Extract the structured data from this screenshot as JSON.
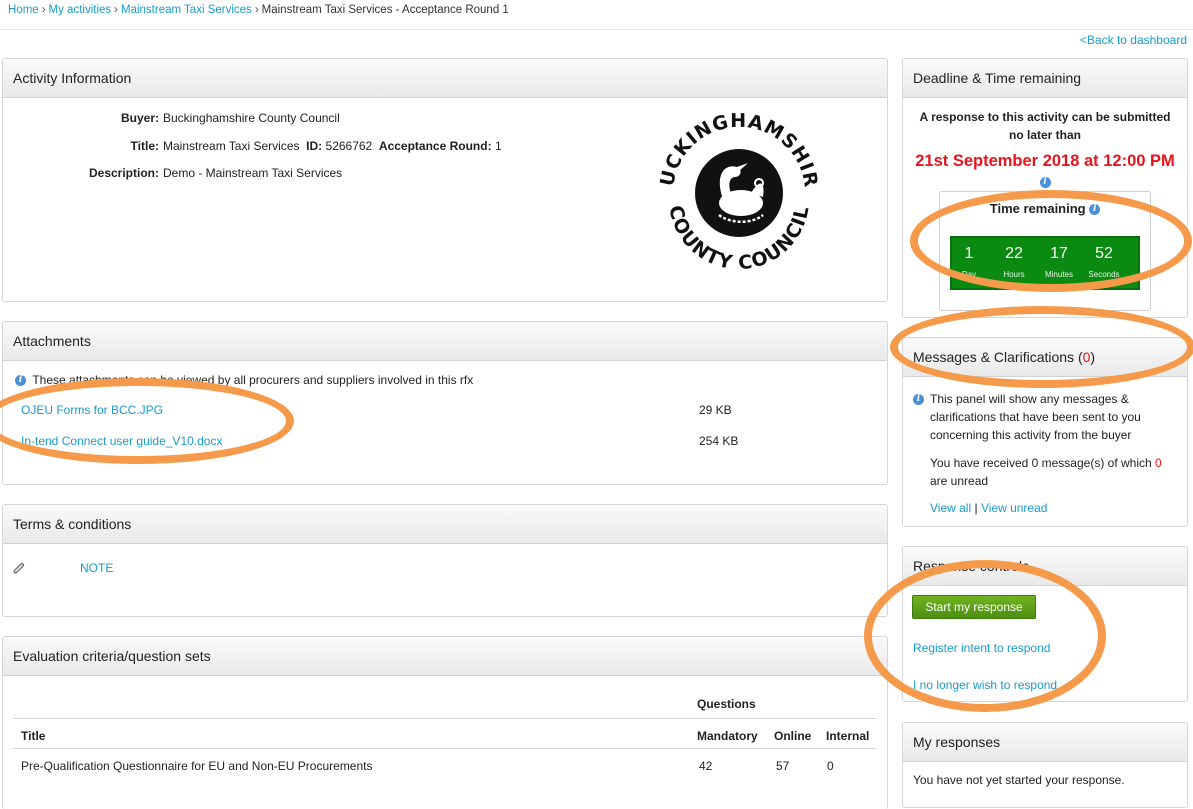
{
  "breadcrumb": {
    "home": "Home",
    "sep": "›",
    "my_activities": "My activities",
    "service": "Mainstream Taxi Services",
    "current": "Mainstream Taxi Services - Acceptance Round 1"
  },
  "back_link": "<Back to dashboard",
  "activity": {
    "heading": "Activity Information",
    "buyer_label": "Buyer:",
    "buyer": "Buckinghamshire County Council",
    "title_label": "Title:",
    "title": "Mainstream Taxi Services",
    "id_label": "ID:",
    "id": "5266762",
    "round_label": "Acceptance Round:",
    "round": "1",
    "description_label": "Description:",
    "description": "Demo - Mainstream Taxi Services",
    "logo_top": "BUCKINGHAMSHIRE",
    "logo_bottom": "· COUNTY COUNCIL ·"
  },
  "attachments": {
    "heading": "Attachments",
    "note": "These attachments can be viewed by all procurers and suppliers involved in this rfx",
    "files": [
      {
        "name": "OJEU Forms for BCC.JPG",
        "size": "29 KB"
      },
      {
        "name": "In-tend Connect user guide_V10.docx",
        "size": "254 KB"
      }
    ]
  },
  "terms": {
    "heading": "Terms & conditions",
    "link": "NOTE"
  },
  "evaluation": {
    "heading": "Evaluation criteria/question sets",
    "questions_header": "Questions",
    "columns": [
      "Title",
      "Mandatory",
      "Online",
      "Internal"
    ],
    "rows": [
      {
        "title": "Pre-Qualification Questionnaire for EU and Non-EU Procurements",
        "mandatory": "42",
        "online": "57",
        "internal": "0"
      }
    ]
  },
  "deadline": {
    "heading": "Deadline & Time remaining",
    "line1": "A response to this activity can be submitted",
    "line2": "no later than",
    "date": "21st September 2018 at 12:00 PM",
    "timer_title": "Time remaining",
    "timer": [
      {
        "value": "1",
        "unit": "Day"
      },
      {
        "value": "22",
        "unit": "Hours"
      },
      {
        "value": "17",
        "unit": "Minutes"
      },
      {
        "value": "52",
        "unit": "Seconds"
      }
    ]
  },
  "messages": {
    "heading_text": "Messages & Clarifications (",
    "count": "0",
    "heading_close": ")",
    "info": [
      "This panel will show any messages &",
      "clarifications that have been sent to you",
      "concerning this activity from the buyer"
    ],
    "received_text": "You have received 0 message(s) of which",
    "unread_count": "0",
    "are_unread": "are unread",
    "view_all": "View all",
    "divider": "|",
    "view_unread": "View unread"
  },
  "response": {
    "heading": "Response controls",
    "start_button": "Start my response",
    "register_intent": "Register intent to respond",
    "no_longer": "I no longer wish to respond"
  },
  "my_responses": {
    "heading": "My responses",
    "text": "You have not yet started your response."
  },
  "colors": {
    "link": "#1a9bc9",
    "deadline_red": "#e8141b",
    "timer_green": "#0b8a12",
    "annotation_orange": "#f59a4a"
  }
}
